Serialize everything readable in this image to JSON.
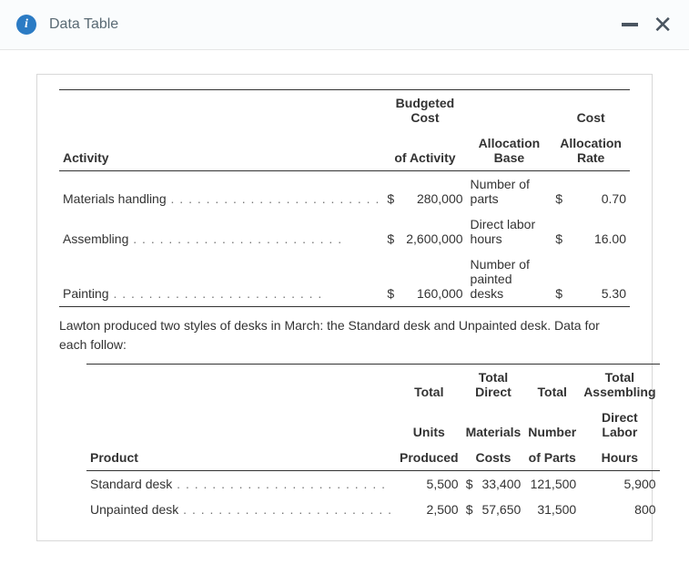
{
  "header": {
    "title": "Data Table"
  },
  "table1": {
    "head": {
      "activity": "Activity",
      "budgeted_line1": "Budgeted Cost",
      "budgeted_line2": "of Activity",
      "allocation_base": "Allocation Base",
      "cost_line1": "Cost",
      "cost_line2": "Allocation Rate"
    },
    "rows": [
      {
        "activity": "Materials handling",
        "cur": "$",
        "amount": "280,000",
        "base": "Number of parts",
        "cur2": "$",
        "rate": "0.70"
      },
      {
        "activity": "Assembling",
        "cur": "$",
        "amount": "2,600,000",
        "base": "Direct labor hours",
        "cur2": "$",
        "rate": "16.00"
      },
      {
        "activity": "Painting",
        "cur": "$",
        "amount": "160,000",
        "base": "Number of painted desks",
        "cur2": "$",
        "rate": "5.30"
      }
    ]
  },
  "narrative": "Lawton produced two styles of desks in March: the Standard desk and Unpainted desk. Data for each follow:",
  "table2": {
    "head": {
      "product": "Product",
      "units_l1": "Total",
      "units_l2": "Units",
      "units_l3": "Produced",
      "mat_l1": "Total Direct",
      "mat_l2": "Materials",
      "mat_l3": "Costs",
      "parts_l1": "Total",
      "parts_l2": "Number",
      "parts_l3": "of Parts",
      "hours_l1": "Total Assembling",
      "hours_l2": "Direct Labor",
      "hours_l3": "Hours"
    },
    "rows": [
      {
        "product": "Standard desk",
        "units": "5,500",
        "cur": "$",
        "materials": "33,400",
        "parts": "121,500",
        "hours": "5,900"
      },
      {
        "product": "Unpainted desk",
        "units": "2,500",
        "cur": "$",
        "materials": "57,650",
        "parts": "31,500",
        "hours": "800"
      }
    ]
  },
  "chart_data": [
    {
      "type": "table",
      "title": "Activity Cost Pool",
      "columns": [
        "Activity",
        "Budgeted Cost of Activity ($)",
        "Allocation Base",
        "Cost Allocation Rate ($)"
      ],
      "rows": [
        [
          "Materials handling",
          280000,
          "Number of parts",
          0.7
        ],
        [
          "Assembling",
          2600000,
          "Direct labor hours",
          16.0
        ],
        [
          "Painting",
          160000,
          "Number of painted desks",
          5.3
        ]
      ]
    },
    {
      "type": "table",
      "title": "Product Data",
      "columns": [
        "Product",
        "Total Units Produced",
        "Total Direct Materials Costs ($)",
        "Total Number of Parts",
        "Total Assembling Direct Labor Hours"
      ],
      "rows": [
        [
          "Standard desk",
          5500,
          33400,
          121500,
          5900
        ],
        [
          "Unpainted desk",
          2500,
          57650,
          31500,
          800
        ]
      ]
    }
  ]
}
